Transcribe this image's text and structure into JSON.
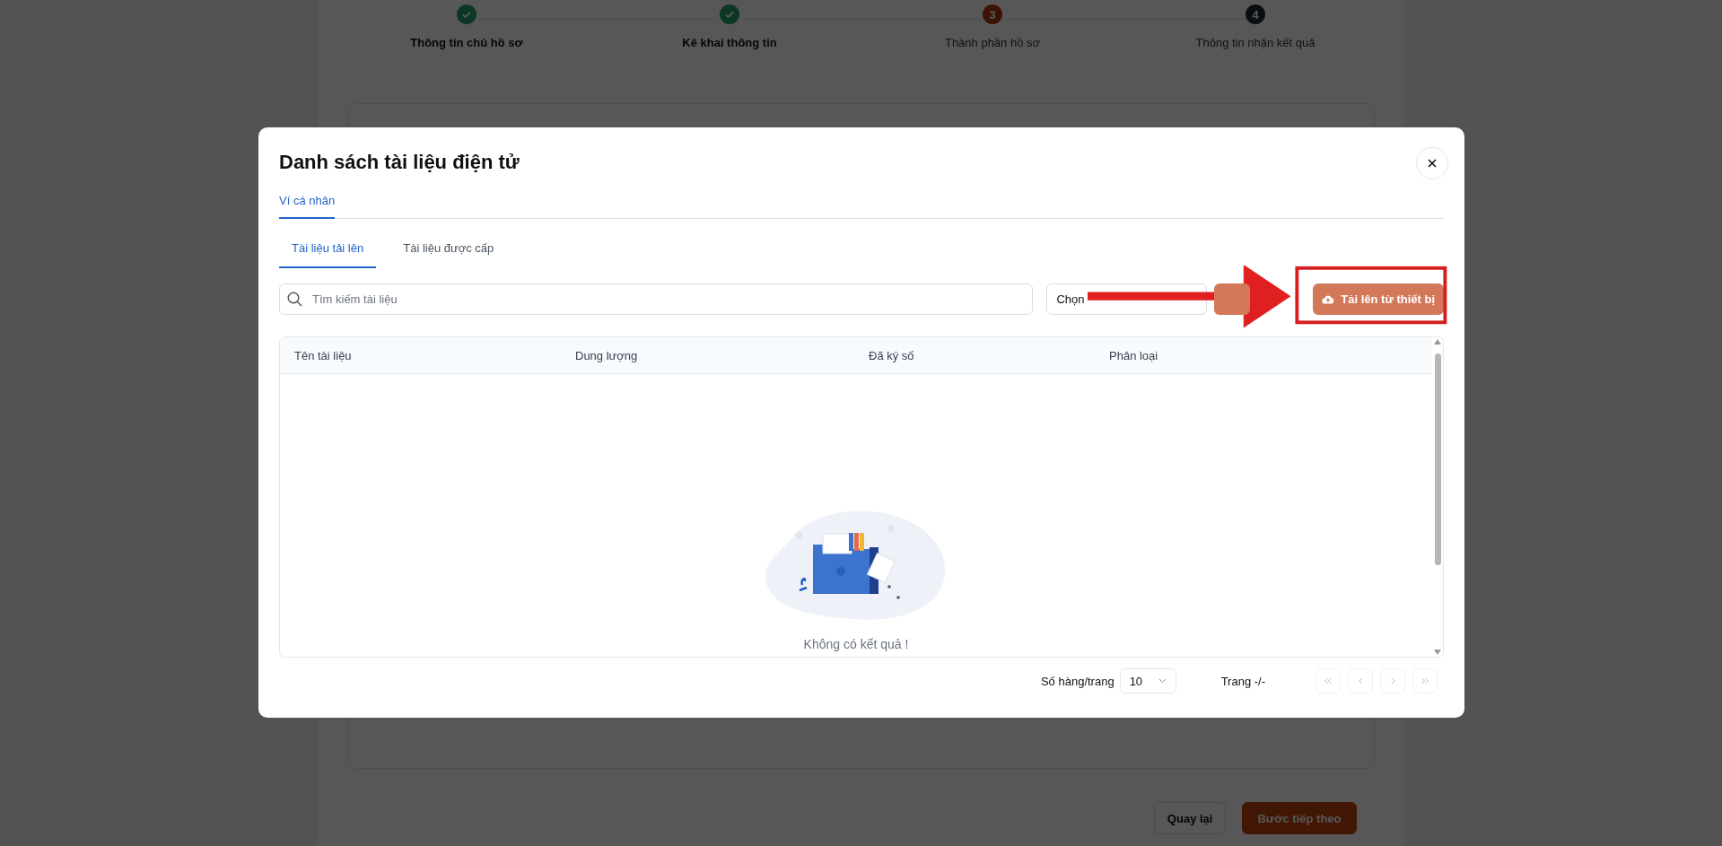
{
  "page": {
    "steps": [
      {
        "label": "Thông tin chủ hồ sơ",
        "done": true
      },
      {
        "label": "Kê khai thông tin",
        "done": true
      },
      {
        "number": "3",
        "label": "Thành phần hồ sơ",
        "done": false,
        "current": true
      },
      {
        "number": "4",
        "label": "Thông tin nhận kết quả",
        "done": false,
        "current": false
      }
    ],
    "buttons": [
      {
        "label": "Quay lại",
        "kind": "secondary"
      },
      {
        "label": "Bước tiếp theo",
        "kind": "primary"
      }
    ]
  },
  "modal": {
    "title": "Danh sách tài liệu điện tử",
    "tabs": [
      {
        "label": "Ví cá nhân",
        "selected": true
      }
    ],
    "subtabs": [
      {
        "label": "Tài liệu tải lên",
        "selected": true
      },
      {
        "label": "Tài liệu được cấp",
        "selected": false
      }
    ],
    "search": {
      "placeholder": "Tìm kiếm tài liệu"
    },
    "filter": {
      "value": "Chọn"
    },
    "upload_button": {
      "label": "Tải lên từ thiết bị"
    },
    "table": {
      "columns": [
        "Tên tài liệu",
        "Dung lượng",
        "Đã ký số",
        "Phân loại"
      ],
      "empty_text": "Không có kết quả !"
    },
    "pagination": {
      "rows_label": "Số hàng/trang",
      "page_size": "10",
      "page_text": "Trang -/-"
    }
  }
}
